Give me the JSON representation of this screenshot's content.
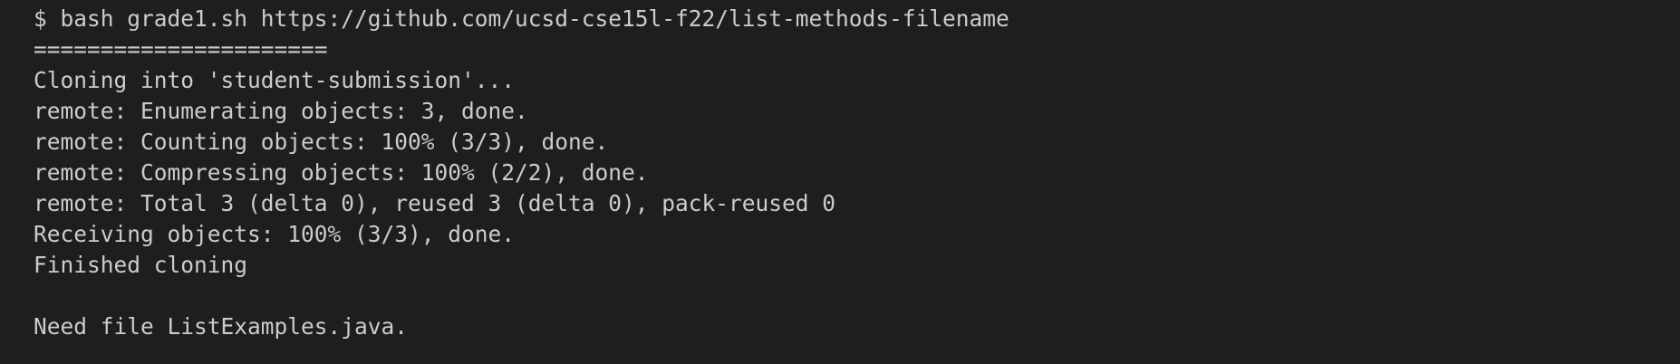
{
  "terminal": {
    "lines": [
      "$ bash grade1.sh https://github.com/ucsd-cse15l-f22/list-methods-filename",
      "======================",
      "Cloning into 'student-submission'...",
      "remote: Enumerating objects: 3, done.",
      "remote: Counting objects: 100% (3/3), done.",
      "remote: Compressing objects: 100% (2/2), done.",
      "remote: Total 3 (delta 0), reused 3 (delta 0), pack-reused 0",
      "Receiving objects: 100% (3/3), done.",
      "Finished cloning",
      "",
      "Need file ListExamples.java."
    ]
  }
}
